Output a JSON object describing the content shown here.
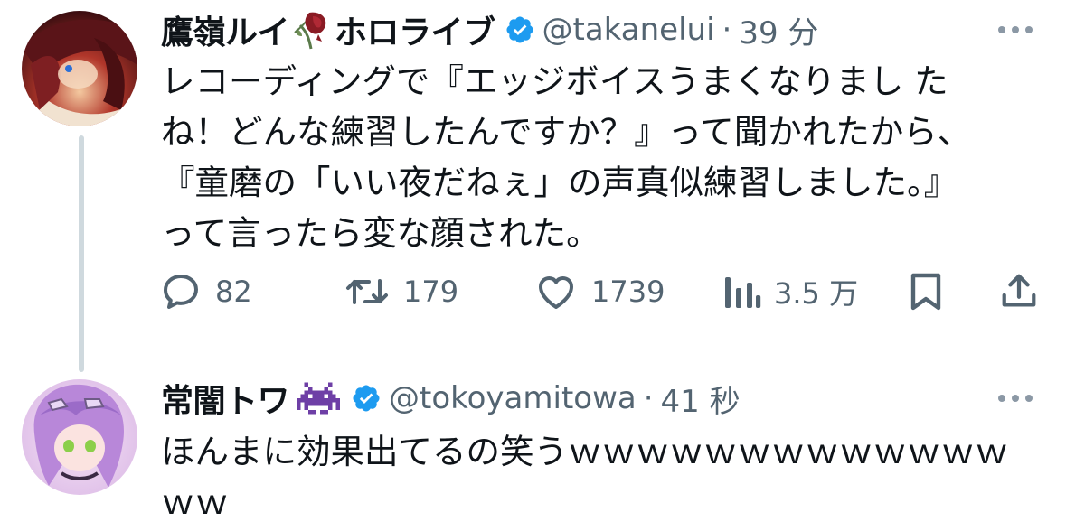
{
  "tweets": [
    {
      "display_name": "鷹嶺ルイ",
      "name_suffix": "ホロライブ",
      "handle": "@takanelui",
      "separator": "·",
      "time": "39 分",
      "name_emoji": "wilted-rose-icon",
      "text": "レコーディングで『エッジボイスうまくなりまし た\nね！どんな練習したんですか？』って聞かれたから、\n『童磨の「いい夜だねぇ」の声真似練習しました。』\nって言ったら変な顔された。",
      "stats": {
        "replies": "82",
        "retweets": "179",
        "likes": "1739",
        "views": "3.5 万"
      }
    },
    {
      "display_name": "常闇トワ",
      "handle": "@tokoyamitowa",
      "separator": "·",
      "time": "41 秒",
      "name_emoji": "space-invader-icon",
      "text": "ほんまに効果出てるの笑うｗｗｗｗｗｗｗｗｗｗｗｗｗ\nｗｗ"
    }
  ],
  "colors": {
    "text": "#0f1419",
    "secondary": "#536471",
    "verified": "#1d9bf0",
    "thread_line": "#cfd9de",
    "invader": "#6e3fa6"
  }
}
